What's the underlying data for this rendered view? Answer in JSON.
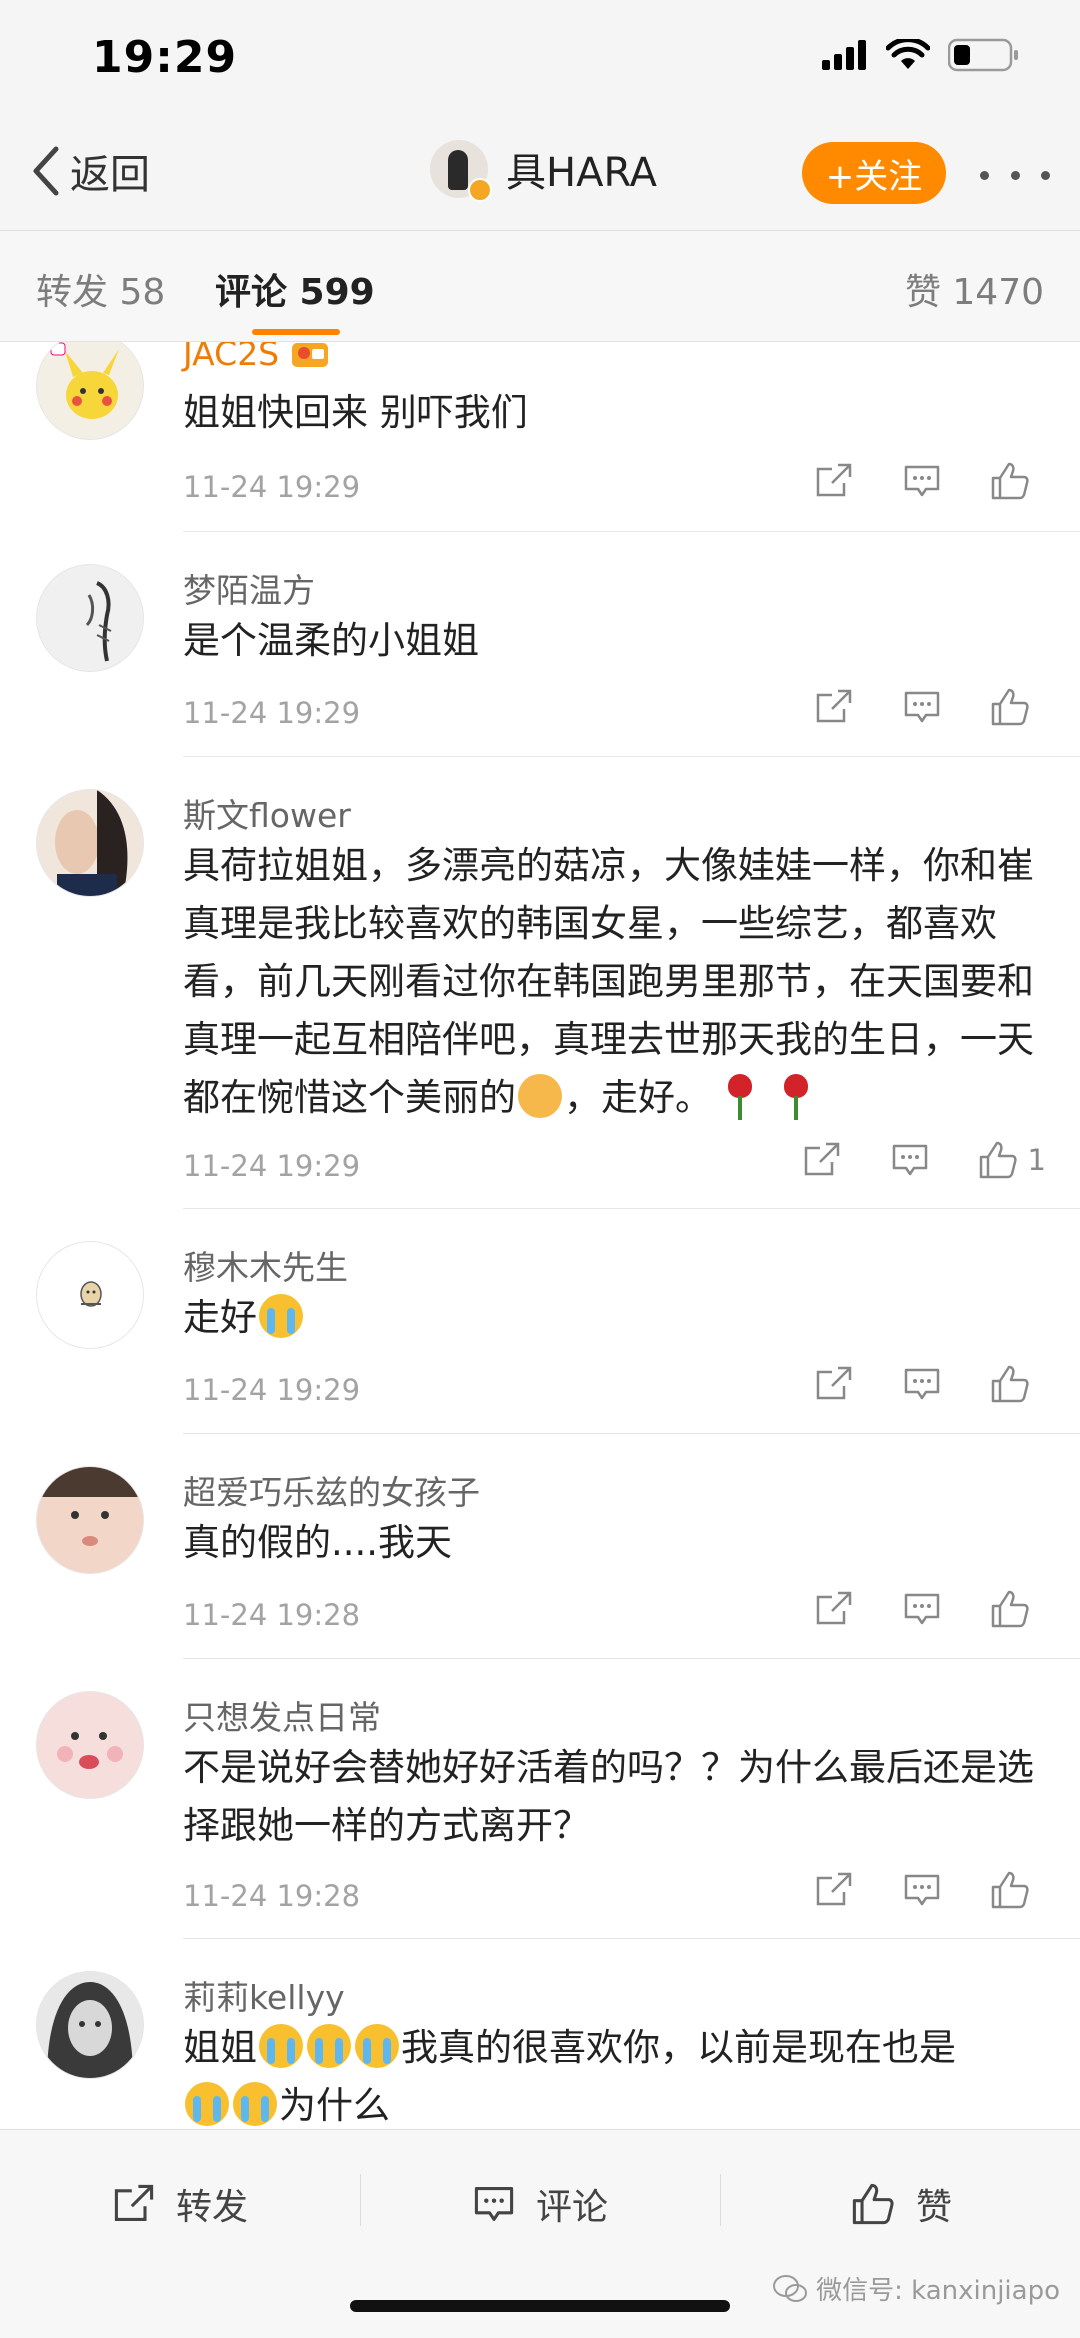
{
  "status_bar": {
    "time": "19:29"
  },
  "nav": {
    "back_label": "返回",
    "profile_name": "具HARA",
    "follow_label": "+关注"
  },
  "tabs": {
    "repost": "转发 58",
    "comment": "评论 599",
    "like": "赞 1470"
  },
  "comments": [
    {
      "name": "JAC2S",
      "text": "姐姐快回来 别吓我们",
      "time": "11-24 19:29",
      "likes": ""
    },
    {
      "name": "梦陌温方",
      "text": "是个温柔的小姐姐",
      "time": "11-24 19:29",
      "likes": ""
    },
    {
      "name": "斯文flower",
      "text_part1": "具荷拉姐姐，多漂亮的菇凉，大像娃娃一样，你和崔真理是我比较喜欢的韩国女星，一些综艺，都喜欢看，前几天刚看过你在韩国跑男里那节，在天国要和真理一起互相陪伴吧，真理去世那天我的生日，一天都在惋惜这个美丽的",
      "text_part2": "，走好。",
      "time": "11-24 19:29",
      "likes": "1"
    },
    {
      "name": "穆木木先生",
      "text": "走好",
      "time": "11-24 19:29",
      "likes": ""
    },
    {
      "name": "超爱巧乐兹的女孩子",
      "text": "真的假的....我天",
      "time": "11-24 19:28",
      "likes": ""
    },
    {
      "name": "只想发点日常",
      "text": "不是说好会替她好好活着的吗？？为什么最后还是选择跟她一样的方式离开？",
      "time": "11-24 19:28",
      "likes": ""
    },
    {
      "name": "莉莉kellyy",
      "text_part1": "姐姐",
      "text_part2": "我真的很喜欢你，以前是现在也是",
      "text_part3": "为什么"
    }
  ],
  "bottom_bar": {
    "repost": "转发",
    "comment": "评论",
    "like": "赞"
  },
  "watermark": "微信号: kanxinjiapo",
  "colors": {
    "accent": "#ff8200",
    "follow_button": "#ff8a00",
    "username_vip": "#f07b05"
  }
}
